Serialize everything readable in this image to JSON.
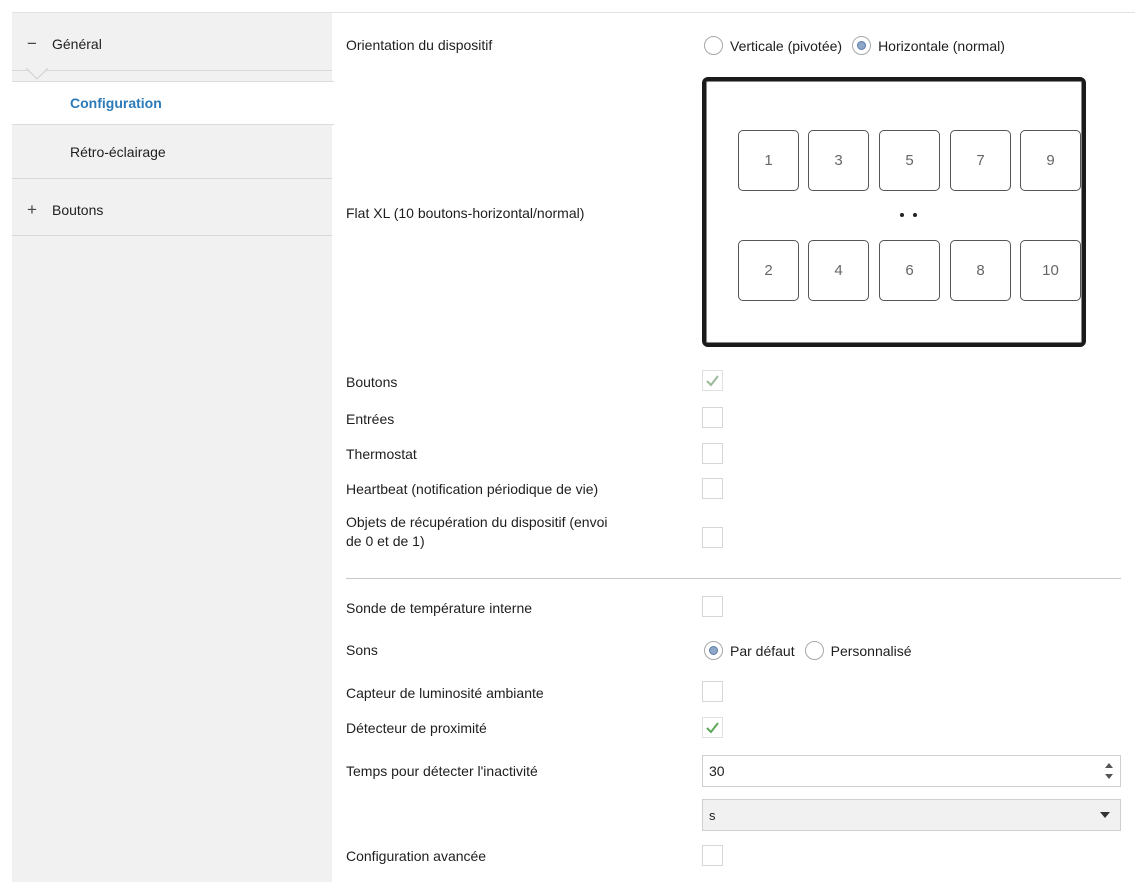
{
  "sidebar": {
    "groups": [
      {
        "sign": "−",
        "label": "Général"
      },
      {
        "sign": "+",
        "label": "Boutons"
      }
    ],
    "items": [
      {
        "label": "Configuration"
      },
      {
        "label": "Rétro-éclairage"
      }
    ]
  },
  "orientation": {
    "label": "Orientation du dispositif",
    "options": [
      "Verticale (pivotée)",
      "Horizontale (normal)"
    ],
    "selected": "Horizontale (normal)"
  },
  "device": {
    "label": "Flat XL (10 boutons-horizontal/normal)",
    "top_row": [
      "1",
      "3",
      "5",
      "7",
      "9"
    ],
    "bottom_row": [
      "2",
      "4",
      "6",
      "8",
      "10"
    ]
  },
  "modules": [
    {
      "label": "Boutons",
      "checked": true
    },
    {
      "label": "Entrées",
      "checked": false
    },
    {
      "label": "Thermostat",
      "checked": false
    },
    {
      "label": "Heartbeat (notification périodique de vie)",
      "checked": false
    },
    {
      "label": "Objets de récupération du dispositif (envoi de 0 et de 1)",
      "line1": "Objets de récupération du dispositif (envoi",
      "line2": "de 0 et de 1)",
      "checked": false
    }
  ],
  "settings": {
    "temp_probe": {
      "label": "Sonde de température interne",
      "checked": false
    },
    "sounds": {
      "label": "Sons",
      "options": [
        "Par défaut",
        "Personnalisé"
      ],
      "selected": "Par défaut"
    },
    "light_sensor": {
      "label": "Capteur de luminosité ambiante",
      "checked": false
    },
    "proximity": {
      "label": "Détecteur de proximité",
      "checked": true
    },
    "inactivity": {
      "label": "Temps pour détecter l'inactivité",
      "value": "30",
      "unit": "s"
    },
    "advanced": {
      "label": "Configuration avancée",
      "checked": false
    }
  },
  "colors": {
    "accent": "#2c7ab8",
    "check": "#5fa85a",
    "sidebar_bg": "#f1f1f1"
  }
}
